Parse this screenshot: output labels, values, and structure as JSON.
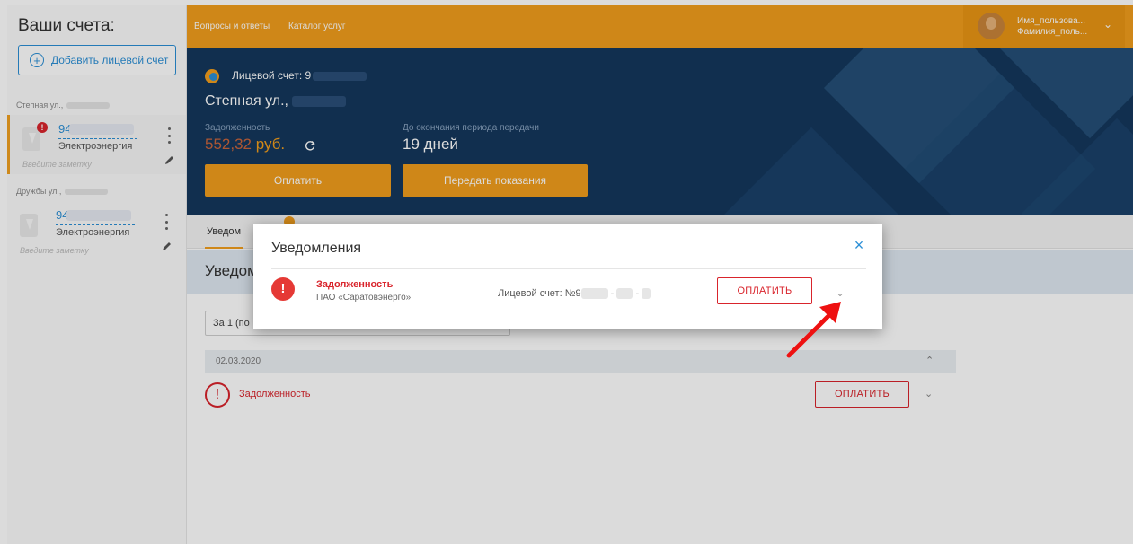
{
  "sidebar": {
    "title": "Ваши счета:",
    "add_account": "Добавить лицевой счет",
    "groups": [
      {
        "street": "Степная ул.,",
        "account_prefix": "94",
        "type": "Электроэнергия",
        "note_placeholder": "Введите заметку",
        "has_alert": true,
        "alert_mark": "!"
      },
      {
        "street": "Дружбы ул.,",
        "account_prefix": "94",
        "type": "Электроэнергия",
        "note_placeholder": "Введите заметку",
        "has_alert": false
      }
    ]
  },
  "topbar": {
    "links": [
      "Вопросы и ответы",
      "Каталог услуг"
    ],
    "user": {
      "line1": "Имя_пользова...",
      "line2": "Фамилия_поль..."
    }
  },
  "hero": {
    "account_label": "Лицевой счет: 9",
    "address": "Степная ул.,",
    "debt_label": "Задолженность",
    "debt_amount": "552,32",
    "debt_currency": "руб.",
    "period_label": "До окончания периода передачи",
    "period_value": "19 дней",
    "pay_button": "Оплатить",
    "submit_button": "Передать показания"
  },
  "content": {
    "tab_label": "Уведом",
    "section_title": "Уведом",
    "filter_value": "За 1 (по",
    "date": "02.03.2020",
    "row_alert_mark": "!",
    "row_title": "Задолженность",
    "row_pay_button": "ОПЛАТИТЬ"
  },
  "modal": {
    "title": "Уведомления",
    "close": "×",
    "alert_mark": "!",
    "notification_title": "Задолженность",
    "notification_org": "ПАО «Саратовэнерго»",
    "account_label": "Лицевой счет: №9",
    "pay_button": "ОПЛАТИТЬ"
  },
  "icons": {
    "add": "plus-circle-icon",
    "refresh": "refresh-icon",
    "edit": "pencil-icon",
    "menu": "kebab-icon",
    "expand": "chevron-down-icon",
    "collapse": "chevron-up-icon",
    "annotation": "red-arrow-icon"
  },
  "colors": {
    "accent_orange": "#f29e1c",
    "hero_navy": "#14375c",
    "alert_red": "#d9242c",
    "link_blue": "#2b8fd6"
  }
}
